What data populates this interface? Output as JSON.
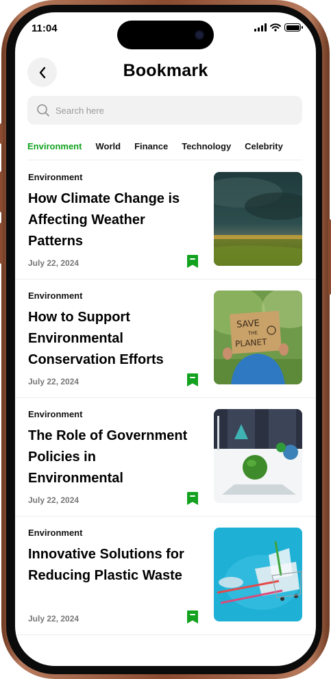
{
  "status": {
    "time": "11:04"
  },
  "header": {
    "title": "Bookmark"
  },
  "search": {
    "placeholder": "Search here"
  },
  "tabs": [
    {
      "label": "Environment",
      "active": true
    },
    {
      "label": "World",
      "active": false
    },
    {
      "label": "Finance",
      "active": false
    },
    {
      "label": "Technology",
      "active": false
    },
    {
      "label": "Celebrity",
      "active": false
    }
  ],
  "articles": [
    {
      "category": "Environment",
      "title": "How Climate Change is Affecting Weather Patterns",
      "date": "July 22, 2024",
      "image": "storm-over-field"
    },
    {
      "category": "Environment",
      "title": "How to Support Environmental Conservation Efforts",
      "date": "July 22, 2024",
      "image": "save-the-planet-sign"
    },
    {
      "category": "Environment",
      "title": "The Role of Government Policies in Environmental",
      "date": "July 22, 2024",
      "image": "globes-on-desk"
    },
    {
      "category": "Environment",
      "title": "Innovative Solutions for Reducing Plastic Waste",
      "date": "July 22, 2024",
      "image": "plastic-waste-cart"
    }
  ],
  "sign_text": {
    "line1": "SAVE",
    "line2": "THE",
    "line3": "PLANET"
  },
  "colors": {
    "accent": "#12a21f",
    "frame": "#8a4b30"
  }
}
